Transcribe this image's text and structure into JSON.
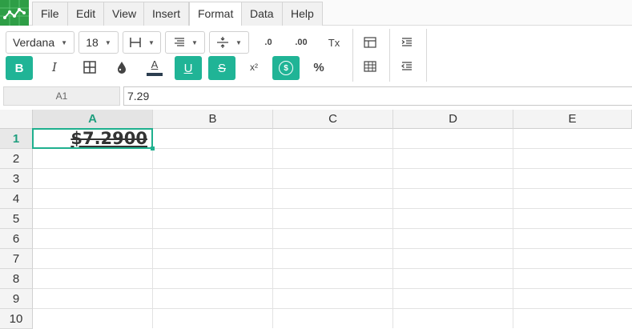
{
  "menu": {
    "items": [
      "File",
      "Edit",
      "View",
      "Insert",
      "Format",
      "Data",
      "Help"
    ],
    "active": "Format"
  },
  "toolbar": {
    "font_family": "Verdana",
    "font_size": "18",
    "icons": {
      "bold": "B",
      "italic": "I",
      "underline": "U",
      "strike": "S",
      "font_color": "A",
      "superscript": "x²",
      "percent": "%",
      "currency": "$",
      "decimal_decrease": ".0",
      "decimal_increase": ".00",
      "clear_format": "Tx"
    },
    "active_states": {
      "bold": true,
      "underline": true,
      "strikethrough": true,
      "currency": true
    },
    "accent_color": "#20b496"
  },
  "formula_bar": {
    "cell_ref": "A1",
    "value": "7.29"
  },
  "sheet": {
    "columns": [
      "A",
      "B",
      "C",
      "D",
      "E"
    ],
    "rows": [
      "1",
      "2",
      "3",
      "4",
      "5",
      "6",
      "7",
      "8",
      "9",
      "10"
    ],
    "selected_cell": "A1",
    "cells": {
      "A1": "$7.2900"
    }
  }
}
